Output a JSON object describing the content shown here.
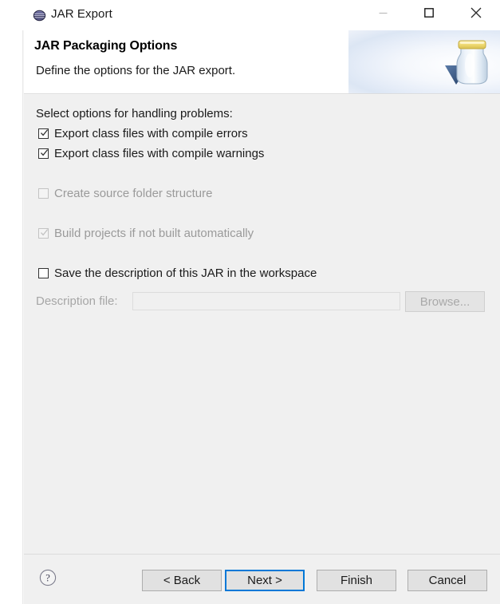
{
  "window": {
    "title": "JAR Export",
    "title_icon": "jar-export-icon",
    "controls": {
      "minimize": "—",
      "maximize": "☐",
      "close": "✕"
    }
  },
  "header": {
    "title": "JAR Packaging Options",
    "description": "Define the options for the JAR export.",
    "banner_icon": "jar-banner-icon"
  },
  "content": {
    "section_label": "Select options for handling problems:",
    "options": [
      {
        "label": "Export class files with compile errors",
        "checked": true,
        "enabled": true
      },
      {
        "label": "Export class files with compile warnings",
        "checked": true,
        "enabled": true
      },
      {
        "label": "Create source folder structure",
        "checked": false,
        "enabled": false
      },
      {
        "label": "Build projects if not built automatically",
        "checked": true,
        "enabled": false
      },
      {
        "label": "Save the description of this JAR in the workspace",
        "checked": false,
        "enabled": true
      }
    ],
    "description_file": {
      "label": "Description file:",
      "value": "",
      "placeholder": "",
      "enabled": false,
      "browse_label": "Browse..."
    }
  },
  "footer": {
    "help_icon": "help-question-icon",
    "buttons": {
      "back": "< Back",
      "next": "Next >",
      "finish": "Finish",
      "cancel": "Cancel"
    },
    "focused_button": "Next >"
  },
  "colors": {
    "accent_focus": "#0078d7",
    "content_bg": "#f0f0f0",
    "header_bg": "#ffffff",
    "text": "#1a1a1a",
    "text_disabled": "#9a9a9a"
  }
}
